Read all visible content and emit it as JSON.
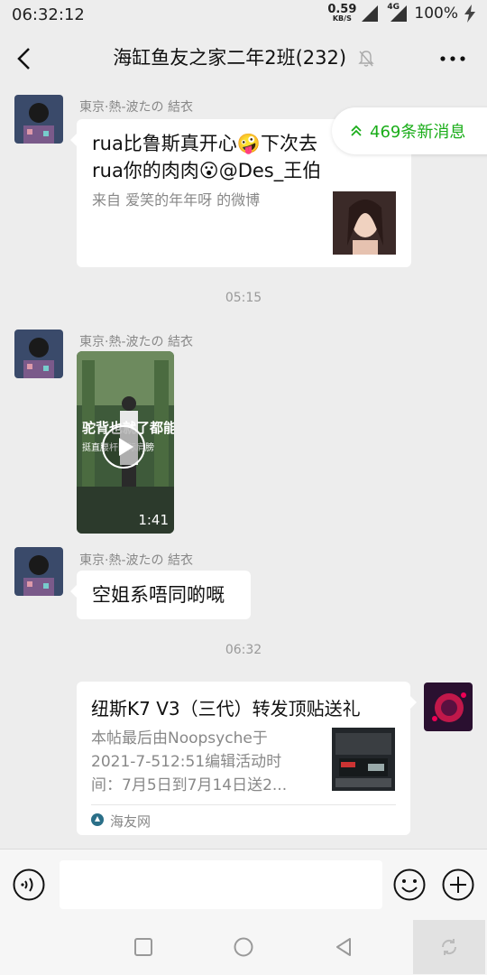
{
  "status": {
    "time": "06:32:12",
    "net_speed": "0.59",
    "net_unit": "KB/S",
    "net_type": "4G",
    "battery": "100%"
  },
  "header": {
    "title": "海缸鱼友之家二年2班(232)"
  },
  "new_messages": {
    "label": "469条新消息"
  },
  "messages": [
    {
      "sender": "東京·熱-波たの 結衣",
      "line1": "rua比鲁斯真开心🤪下次去",
      "line2": "rua你的肉肉😮@Des_王伯",
      "source": "来自 爱笑的年年呀 的微博"
    },
    {
      "time": "05:15"
    },
    {
      "sender": "東京·熱-波たの 結衣",
      "video_duration": "1:41",
      "video_caption": "驼背也就了都能",
      "video_subcaption": "挺直腰杆国际肩膀"
    },
    {
      "sender": "東京·熱-波たの 結衣",
      "text": "空姐系唔同啲嘅"
    },
    {
      "time": "06:32"
    },
    {
      "title": "纽斯K7 V3（三代）转发顶贴送礼",
      "desc_line1": "本帖最后由Noopsyche于",
      "desc_line2": "2021-7-512:51编辑活动时",
      "desc_line3": "间：7月5日到7月14日送2...",
      "source": "海友网"
    }
  ],
  "colors": {
    "background": "#ededed",
    "bubble": "#ffffff",
    "accent": "#1aad19"
  },
  "icons": [
    "back-arrow-icon",
    "mute-bell-icon",
    "more-icon",
    "play-icon",
    "voice-icon",
    "emoji-icon",
    "plus-icon",
    "nav-square-icon",
    "nav-circle-icon",
    "nav-back-icon",
    "rotate-icon"
  ]
}
